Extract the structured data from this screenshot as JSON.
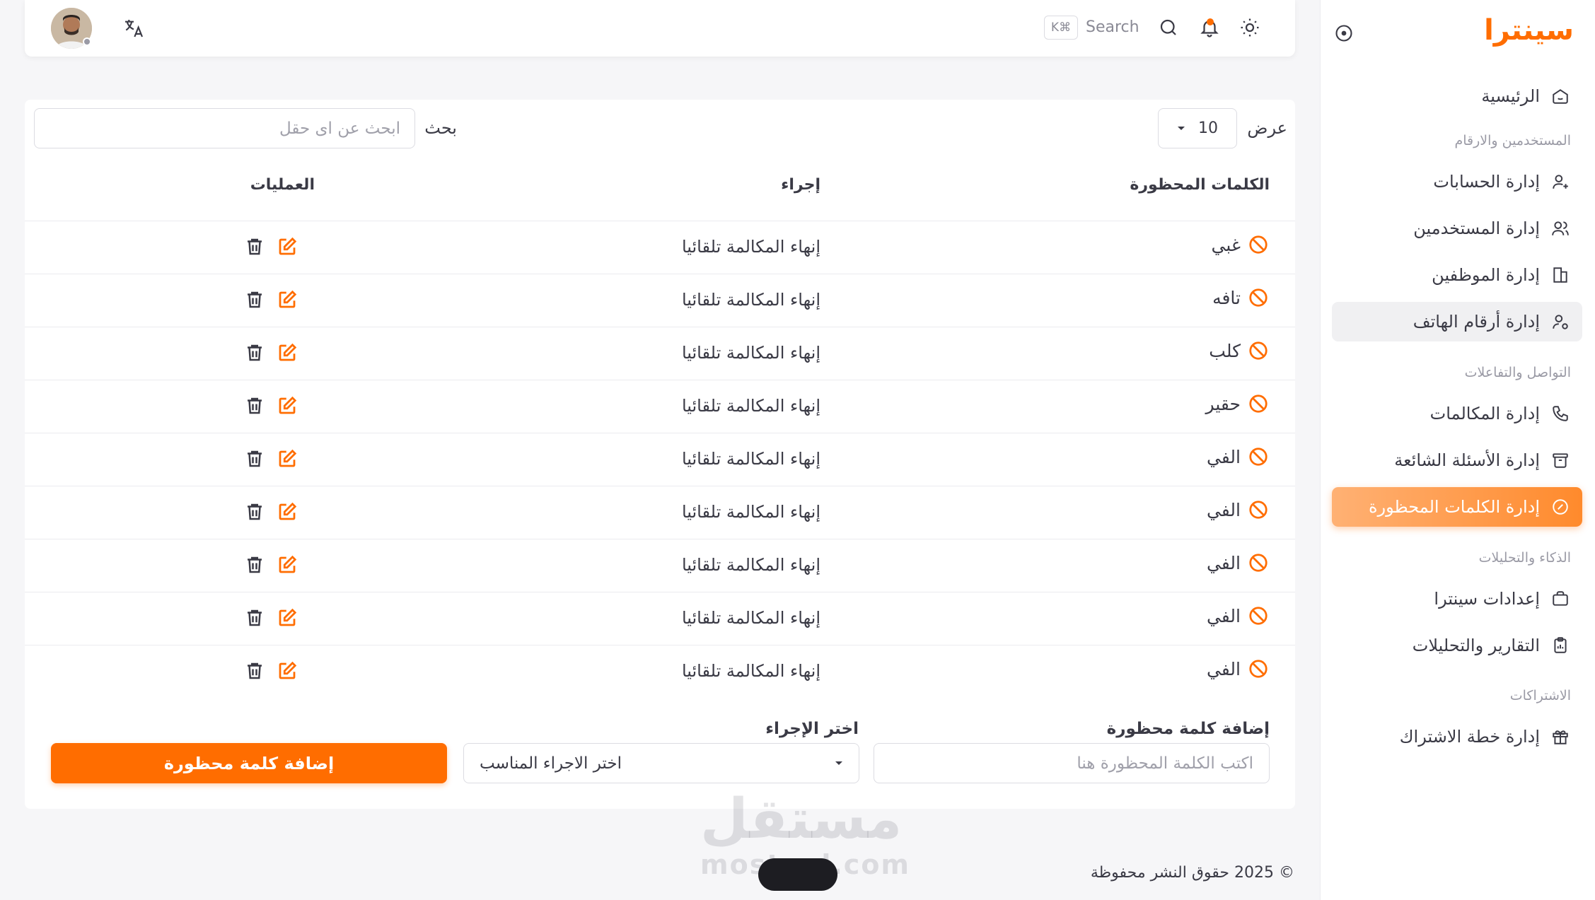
{
  "brand": "سينترا",
  "colors": {
    "accent": "#ff6d00",
    "accent_light": "#ffb174",
    "text": "#3a3a45",
    "muted": "#9a9aa5"
  },
  "topbar": {
    "search_label": "Search",
    "shortcut": "K⌘",
    "icons": [
      "avatar",
      "translate-icon",
      "search-icon",
      "bell-icon",
      "sun-icon"
    ]
  },
  "sidebar": {
    "home": "الرئيسية",
    "sections": {
      "users": "المستخدمين والارقام",
      "comms": "التواصل والتفاعلات",
      "ai": "الذكاء والتحليلات",
      "subs": "الاشتراكات"
    },
    "items": {
      "accounts": "إدارة الحسابات",
      "users": "إدارة المستخدمين",
      "employees": "إدارة الموظفين",
      "phones": "إدارة أرقام الهاتف",
      "calls": "إدارة المكالمات",
      "faq": "إدارة الأسئلة الشائعة",
      "banned": "إدارة الكلمات المحظورة",
      "settings": "إعدادات سينترا",
      "reports": "التقارير والتحليلات",
      "plans": "إدارة خطة الاشتراك"
    }
  },
  "table_controls": {
    "show_label": "عرض",
    "page_size": "10",
    "search_label": "بحث",
    "search_placeholder": "ابحث عن اى حقل"
  },
  "table": {
    "headers": {
      "word": "الكلمات المحظورة",
      "action": "إجراء",
      "ops": "العمليات"
    },
    "rows": [
      {
        "word": "غبي",
        "action": "إنهاء المكالمة تلقائيا"
      },
      {
        "word": "تافه",
        "action": "إنهاء المكالمة تلقائيا"
      },
      {
        "word": "كلب",
        "action": "إنهاء المكالمة تلقائيا"
      },
      {
        "word": "حقير",
        "action": "إنهاء المكالمة تلقائيا"
      },
      {
        "word": "الفي",
        "action": "إنهاء المكالمة تلقائيا"
      },
      {
        "word": "الفي",
        "action": "إنهاء المكالمة تلقائيا"
      },
      {
        "word": "الفي",
        "action": "إنهاء المكالمة تلقائيا"
      },
      {
        "word": "الفي",
        "action": "إنهاء المكالمة تلقائيا"
      },
      {
        "word": "الفي",
        "action": "إنهاء المكالمة تلقائيا"
      }
    ]
  },
  "form": {
    "word_label": "إضافة كلمة محظورة",
    "word_placeholder": "اكتب الكلمة المحظورة هنا",
    "action_label": "اختر الإجراء",
    "action_select": "اختر الاجراء المناسب",
    "submit": "إضافة كلمة محظورة"
  },
  "footer": "© 2025 حقوق النشر محفوظة",
  "watermark": {
    "arabic": "مستقل",
    "latin": "mostaql.com"
  }
}
